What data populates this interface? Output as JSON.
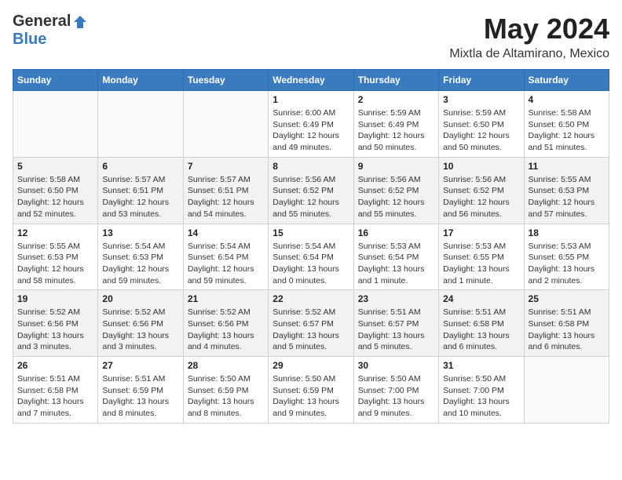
{
  "header": {
    "logo_general": "General",
    "logo_blue": "Blue",
    "month": "May 2024",
    "location": "Mixtla de Altamirano, Mexico"
  },
  "weekdays": [
    "Sunday",
    "Monday",
    "Tuesday",
    "Wednesday",
    "Thursday",
    "Friday",
    "Saturday"
  ],
  "weeks": [
    [
      {
        "day": "",
        "info": ""
      },
      {
        "day": "",
        "info": ""
      },
      {
        "day": "",
        "info": ""
      },
      {
        "day": "1",
        "info": "Sunrise: 6:00 AM\nSunset: 6:49 PM\nDaylight: 12 hours\nand 49 minutes."
      },
      {
        "day": "2",
        "info": "Sunrise: 5:59 AM\nSunset: 6:49 PM\nDaylight: 12 hours\nand 50 minutes."
      },
      {
        "day": "3",
        "info": "Sunrise: 5:59 AM\nSunset: 6:50 PM\nDaylight: 12 hours\nand 50 minutes."
      },
      {
        "day": "4",
        "info": "Sunrise: 5:58 AM\nSunset: 6:50 PM\nDaylight: 12 hours\nand 51 minutes."
      }
    ],
    [
      {
        "day": "5",
        "info": "Sunrise: 5:58 AM\nSunset: 6:50 PM\nDaylight: 12 hours\nand 52 minutes."
      },
      {
        "day": "6",
        "info": "Sunrise: 5:57 AM\nSunset: 6:51 PM\nDaylight: 12 hours\nand 53 minutes."
      },
      {
        "day": "7",
        "info": "Sunrise: 5:57 AM\nSunset: 6:51 PM\nDaylight: 12 hours\nand 54 minutes."
      },
      {
        "day": "8",
        "info": "Sunrise: 5:56 AM\nSunset: 6:52 PM\nDaylight: 12 hours\nand 55 minutes."
      },
      {
        "day": "9",
        "info": "Sunrise: 5:56 AM\nSunset: 6:52 PM\nDaylight: 12 hours\nand 55 minutes."
      },
      {
        "day": "10",
        "info": "Sunrise: 5:56 AM\nSunset: 6:52 PM\nDaylight: 12 hours\nand 56 minutes."
      },
      {
        "day": "11",
        "info": "Sunrise: 5:55 AM\nSunset: 6:53 PM\nDaylight: 12 hours\nand 57 minutes."
      }
    ],
    [
      {
        "day": "12",
        "info": "Sunrise: 5:55 AM\nSunset: 6:53 PM\nDaylight: 12 hours\nand 58 minutes."
      },
      {
        "day": "13",
        "info": "Sunrise: 5:54 AM\nSunset: 6:53 PM\nDaylight: 12 hours\nand 59 minutes."
      },
      {
        "day": "14",
        "info": "Sunrise: 5:54 AM\nSunset: 6:54 PM\nDaylight: 12 hours\nand 59 minutes."
      },
      {
        "day": "15",
        "info": "Sunrise: 5:54 AM\nSunset: 6:54 PM\nDaylight: 13 hours\nand 0 minutes."
      },
      {
        "day": "16",
        "info": "Sunrise: 5:53 AM\nSunset: 6:54 PM\nDaylight: 13 hours\nand 1 minute."
      },
      {
        "day": "17",
        "info": "Sunrise: 5:53 AM\nSunset: 6:55 PM\nDaylight: 13 hours\nand 1 minute."
      },
      {
        "day": "18",
        "info": "Sunrise: 5:53 AM\nSunset: 6:55 PM\nDaylight: 13 hours\nand 2 minutes."
      }
    ],
    [
      {
        "day": "19",
        "info": "Sunrise: 5:52 AM\nSunset: 6:56 PM\nDaylight: 13 hours\nand 3 minutes."
      },
      {
        "day": "20",
        "info": "Sunrise: 5:52 AM\nSunset: 6:56 PM\nDaylight: 13 hours\nand 3 minutes."
      },
      {
        "day": "21",
        "info": "Sunrise: 5:52 AM\nSunset: 6:56 PM\nDaylight: 13 hours\nand 4 minutes."
      },
      {
        "day": "22",
        "info": "Sunrise: 5:52 AM\nSunset: 6:57 PM\nDaylight: 13 hours\nand 5 minutes."
      },
      {
        "day": "23",
        "info": "Sunrise: 5:51 AM\nSunset: 6:57 PM\nDaylight: 13 hours\nand 5 minutes."
      },
      {
        "day": "24",
        "info": "Sunrise: 5:51 AM\nSunset: 6:58 PM\nDaylight: 13 hours\nand 6 minutes."
      },
      {
        "day": "25",
        "info": "Sunrise: 5:51 AM\nSunset: 6:58 PM\nDaylight: 13 hours\nand 6 minutes."
      }
    ],
    [
      {
        "day": "26",
        "info": "Sunrise: 5:51 AM\nSunset: 6:58 PM\nDaylight: 13 hours\nand 7 minutes."
      },
      {
        "day": "27",
        "info": "Sunrise: 5:51 AM\nSunset: 6:59 PM\nDaylight: 13 hours\nand 8 minutes."
      },
      {
        "day": "28",
        "info": "Sunrise: 5:50 AM\nSunset: 6:59 PM\nDaylight: 13 hours\nand 8 minutes."
      },
      {
        "day": "29",
        "info": "Sunrise: 5:50 AM\nSunset: 6:59 PM\nDaylight: 13 hours\nand 9 minutes."
      },
      {
        "day": "30",
        "info": "Sunrise: 5:50 AM\nSunset: 7:00 PM\nDaylight: 13 hours\nand 9 minutes."
      },
      {
        "day": "31",
        "info": "Sunrise: 5:50 AM\nSunset: 7:00 PM\nDaylight: 13 hours\nand 10 minutes."
      },
      {
        "day": "",
        "info": ""
      }
    ]
  ]
}
